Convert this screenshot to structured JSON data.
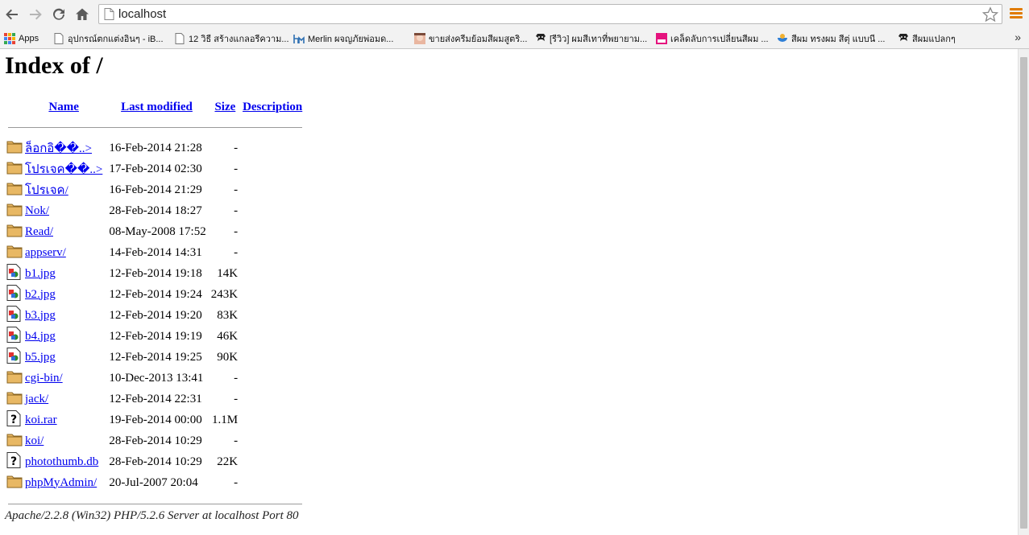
{
  "browser": {
    "url": "localhost",
    "bookmarks": [
      {
        "label": "Apps",
        "icon": "apps-grid-icon"
      },
      {
        "label": "อุปกรณ์ตกแต่งอินๆ - iB...",
        "icon": "page-icon"
      },
      {
        "label": "12 วิธี สร้างแกลอรีความ...",
        "icon": "page-icon"
      },
      {
        "label": "Merlin ผจญภัยพ่อมด...",
        "icon": "hm-logo-icon"
      },
      {
        "label": "ขายส่งครีมย้อมสีผมสูตริ...",
        "icon": "face-icon"
      },
      {
        "label": "[รีวิว] ผมสีเทาที่พยายาม...",
        "icon": "pantip-icon"
      },
      {
        "label": "เคล็ดลับการเปลี่ยนสีผม ...",
        "icon": "mynam-icon"
      },
      {
        "label": "สีผม ทรงผม สีตุ่ แบบนี ...",
        "icon": "bowl-icon"
      },
      {
        "label": "สีผมแปลกๆ",
        "icon": "pantip-icon"
      }
    ],
    "more_bookmarks": "»"
  },
  "listing": {
    "title": "Index of /",
    "columns": {
      "name": "Name",
      "modified": "Last modified",
      "size": "Size",
      "description": "Description"
    },
    "rows": [
      {
        "name": "ล็อกอิ��..>",
        "modified": "16-Feb-2014 21:28",
        "size": "-",
        "type": "folder"
      },
      {
        "name": "โปรเจค��..>",
        "modified": "17-Feb-2014 02:30",
        "size": "-",
        "type": "folder"
      },
      {
        "name": "โปรเจค/",
        "modified": "16-Feb-2014 21:29",
        "size": "-",
        "type": "folder"
      },
      {
        "name": "Nok/",
        "modified": "28-Feb-2014 18:27",
        "size": "-",
        "type": "folder"
      },
      {
        "name": "Read/",
        "modified": "08-May-2008 17:52",
        "size": "-",
        "type": "folder"
      },
      {
        "name": "appserv/",
        "modified": "14-Feb-2014 14:31",
        "size": "-",
        "type": "folder"
      },
      {
        "name": "b1.jpg",
        "modified": "12-Feb-2014 19:18",
        "size": "14K",
        "type": "image"
      },
      {
        "name": "b2.jpg",
        "modified": "12-Feb-2014 19:24",
        "size": "243K",
        "type": "image"
      },
      {
        "name": "b3.jpg",
        "modified": "12-Feb-2014 19:20",
        "size": "83K",
        "type": "image"
      },
      {
        "name": "b4.jpg",
        "modified": "12-Feb-2014 19:19",
        "size": "46K",
        "type": "image"
      },
      {
        "name": "b5.jpg",
        "modified": "12-Feb-2014 19:25",
        "size": "90K",
        "type": "image"
      },
      {
        "name": "cgi-bin/",
        "modified": "10-Dec-2013 13:41",
        "size": "-",
        "type": "folder"
      },
      {
        "name": "jack/",
        "modified": "12-Feb-2014 22:31",
        "size": "-",
        "type": "folder"
      },
      {
        "name": "koi.rar",
        "modified": "19-Feb-2014 00:00",
        "size": "1.1M",
        "type": "unknown"
      },
      {
        "name": "koi/",
        "modified": "28-Feb-2014 10:29",
        "size": "-",
        "type": "folder"
      },
      {
        "name": "photothumb.db",
        "modified": "28-Feb-2014 10:29",
        "size": "22K",
        "type": "unknown"
      },
      {
        "name": "phpMyAdmin/",
        "modified": "20-Jul-2007 20:04",
        "size": "-",
        "type": "folder"
      }
    ],
    "footer": "Apache/2.2.8 (Win32) PHP/5.2.6 Server at localhost Port 80"
  },
  "colors": {
    "link": "#0000ee",
    "folder": "#e8b864",
    "menu": "#e07b00"
  }
}
